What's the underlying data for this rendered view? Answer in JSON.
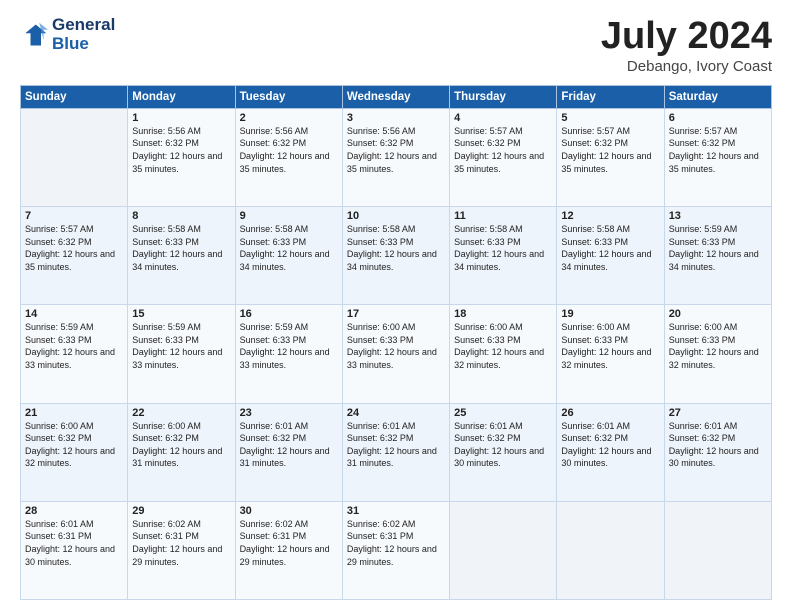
{
  "header": {
    "logo_line1": "General",
    "logo_line2": "Blue",
    "month": "July 2024",
    "location": "Debango, Ivory Coast"
  },
  "weekdays": [
    "Sunday",
    "Monday",
    "Tuesday",
    "Wednesday",
    "Thursday",
    "Friday",
    "Saturday"
  ],
  "weeks": [
    [
      {
        "day": "",
        "sunrise": "",
        "sunset": "",
        "daylight": ""
      },
      {
        "day": "1",
        "sunrise": "Sunrise: 5:56 AM",
        "sunset": "Sunset: 6:32 PM",
        "daylight": "Daylight: 12 hours and 35 minutes."
      },
      {
        "day": "2",
        "sunrise": "Sunrise: 5:56 AM",
        "sunset": "Sunset: 6:32 PM",
        "daylight": "Daylight: 12 hours and 35 minutes."
      },
      {
        "day": "3",
        "sunrise": "Sunrise: 5:56 AM",
        "sunset": "Sunset: 6:32 PM",
        "daylight": "Daylight: 12 hours and 35 minutes."
      },
      {
        "day": "4",
        "sunrise": "Sunrise: 5:57 AM",
        "sunset": "Sunset: 6:32 PM",
        "daylight": "Daylight: 12 hours and 35 minutes."
      },
      {
        "day": "5",
        "sunrise": "Sunrise: 5:57 AM",
        "sunset": "Sunset: 6:32 PM",
        "daylight": "Daylight: 12 hours and 35 minutes."
      },
      {
        "day": "6",
        "sunrise": "Sunrise: 5:57 AM",
        "sunset": "Sunset: 6:32 PM",
        "daylight": "Daylight: 12 hours and 35 minutes."
      }
    ],
    [
      {
        "day": "7",
        "sunrise": "Sunrise: 5:57 AM",
        "sunset": "Sunset: 6:32 PM",
        "daylight": "Daylight: 12 hours and 35 minutes."
      },
      {
        "day": "8",
        "sunrise": "Sunrise: 5:58 AM",
        "sunset": "Sunset: 6:33 PM",
        "daylight": "Daylight: 12 hours and 34 minutes."
      },
      {
        "day": "9",
        "sunrise": "Sunrise: 5:58 AM",
        "sunset": "Sunset: 6:33 PM",
        "daylight": "Daylight: 12 hours and 34 minutes."
      },
      {
        "day": "10",
        "sunrise": "Sunrise: 5:58 AM",
        "sunset": "Sunset: 6:33 PM",
        "daylight": "Daylight: 12 hours and 34 minutes."
      },
      {
        "day": "11",
        "sunrise": "Sunrise: 5:58 AM",
        "sunset": "Sunset: 6:33 PM",
        "daylight": "Daylight: 12 hours and 34 minutes."
      },
      {
        "day": "12",
        "sunrise": "Sunrise: 5:58 AM",
        "sunset": "Sunset: 6:33 PM",
        "daylight": "Daylight: 12 hours and 34 minutes."
      },
      {
        "day": "13",
        "sunrise": "Sunrise: 5:59 AM",
        "sunset": "Sunset: 6:33 PM",
        "daylight": "Daylight: 12 hours and 34 minutes."
      }
    ],
    [
      {
        "day": "14",
        "sunrise": "Sunrise: 5:59 AM",
        "sunset": "Sunset: 6:33 PM",
        "daylight": "Daylight: 12 hours and 33 minutes."
      },
      {
        "day": "15",
        "sunrise": "Sunrise: 5:59 AM",
        "sunset": "Sunset: 6:33 PM",
        "daylight": "Daylight: 12 hours and 33 minutes."
      },
      {
        "day": "16",
        "sunrise": "Sunrise: 5:59 AM",
        "sunset": "Sunset: 6:33 PM",
        "daylight": "Daylight: 12 hours and 33 minutes."
      },
      {
        "day": "17",
        "sunrise": "Sunrise: 6:00 AM",
        "sunset": "Sunset: 6:33 PM",
        "daylight": "Daylight: 12 hours and 33 minutes."
      },
      {
        "day": "18",
        "sunrise": "Sunrise: 6:00 AM",
        "sunset": "Sunset: 6:33 PM",
        "daylight": "Daylight: 12 hours and 32 minutes."
      },
      {
        "day": "19",
        "sunrise": "Sunrise: 6:00 AM",
        "sunset": "Sunset: 6:33 PM",
        "daylight": "Daylight: 12 hours and 32 minutes."
      },
      {
        "day": "20",
        "sunrise": "Sunrise: 6:00 AM",
        "sunset": "Sunset: 6:33 PM",
        "daylight": "Daylight: 12 hours and 32 minutes."
      }
    ],
    [
      {
        "day": "21",
        "sunrise": "Sunrise: 6:00 AM",
        "sunset": "Sunset: 6:32 PM",
        "daylight": "Daylight: 12 hours and 32 minutes."
      },
      {
        "day": "22",
        "sunrise": "Sunrise: 6:00 AM",
        "sunset": "Sunset: 6:32 PM",
        "daylight": "Daylight: 12 hours and 31 minutes."
      },
      {
        "day": "23",
        "sunrise": "Sunrise: 6:01 AM",
        "sunset": "Sunset: 6:32 PM",
        "daylight": "Daylight: 12 hours and 31 minutes."
      },
      {
        "day": "24",
        "sunrise": "Sunrise: 6:01 AM",
        "sunset": "Sunset: 6:32 PM",
        "daylight": "Daylight: 12 hours and 31 minutes."
      },
      {
        "day": "25",
        "sunrise": "Sunrise: 6:01 AM",
        "sunset": "Sunset: 6:32 PM",
        "daylight": "Daylight: 12 hours and 30 minutes."
      },
      {
        "day": "26",
        "sunrise": "Sunrise: 6:01 AM",
        "sunset": "Sunset: 6:32 PM",
        "daylight": "Daylight: 12 hours and 30 minutes."
      },
      {
        "day": "27",
        "sunrise": "Sunrise: 6:01 AM",
        "sunset": "Sunset: 6:32 PM",
        "daylight": "Daylight: 12 hours and 30 minutes."
      }
    ],
    [
      {
        "day": "28",
        "sunrise": "Sunrise: 6:01 AM",
        "sunset": "Sunset: 6:31 PM",
        "daylight": "Daylight: 12 hours and 30 minutes."
      },
      {
        "day": "29",
        "sunrise": "Sunrise: 6:02 AM",
        "sunset": "Sunset: 6:31 PM",
        "daylight": "Daylight: 12 hours and 29 minutes."
      },
      {
        "day": "30",
        "sunrise": "Sunrise: 6:02 AM",
        "sunset": "Sunset: 6:31 PM",
        "daylight": "Daylight: 12 hours and 29 minutes."
      },
      {
        "day": "31",
        "sunrise": "Sunrise: 6:02 AM",
        "sunset": "Sunset: 6:31 PM",
        "daylight": "Daylight: 12 hours and 29 minutes."
      },
      {
        "day": "",
        "sunrise": "",
        "sunset": "",
        "daylight": ""
      },
      {
        "day": "",
        "sunrise": "",
        "sunset": "",
        "daylight": ""
      },
      {
        "day": "",
        "sunrise": "",
        "sunset": "",
        "daylight": ""
      }
    ]
  ]
}
